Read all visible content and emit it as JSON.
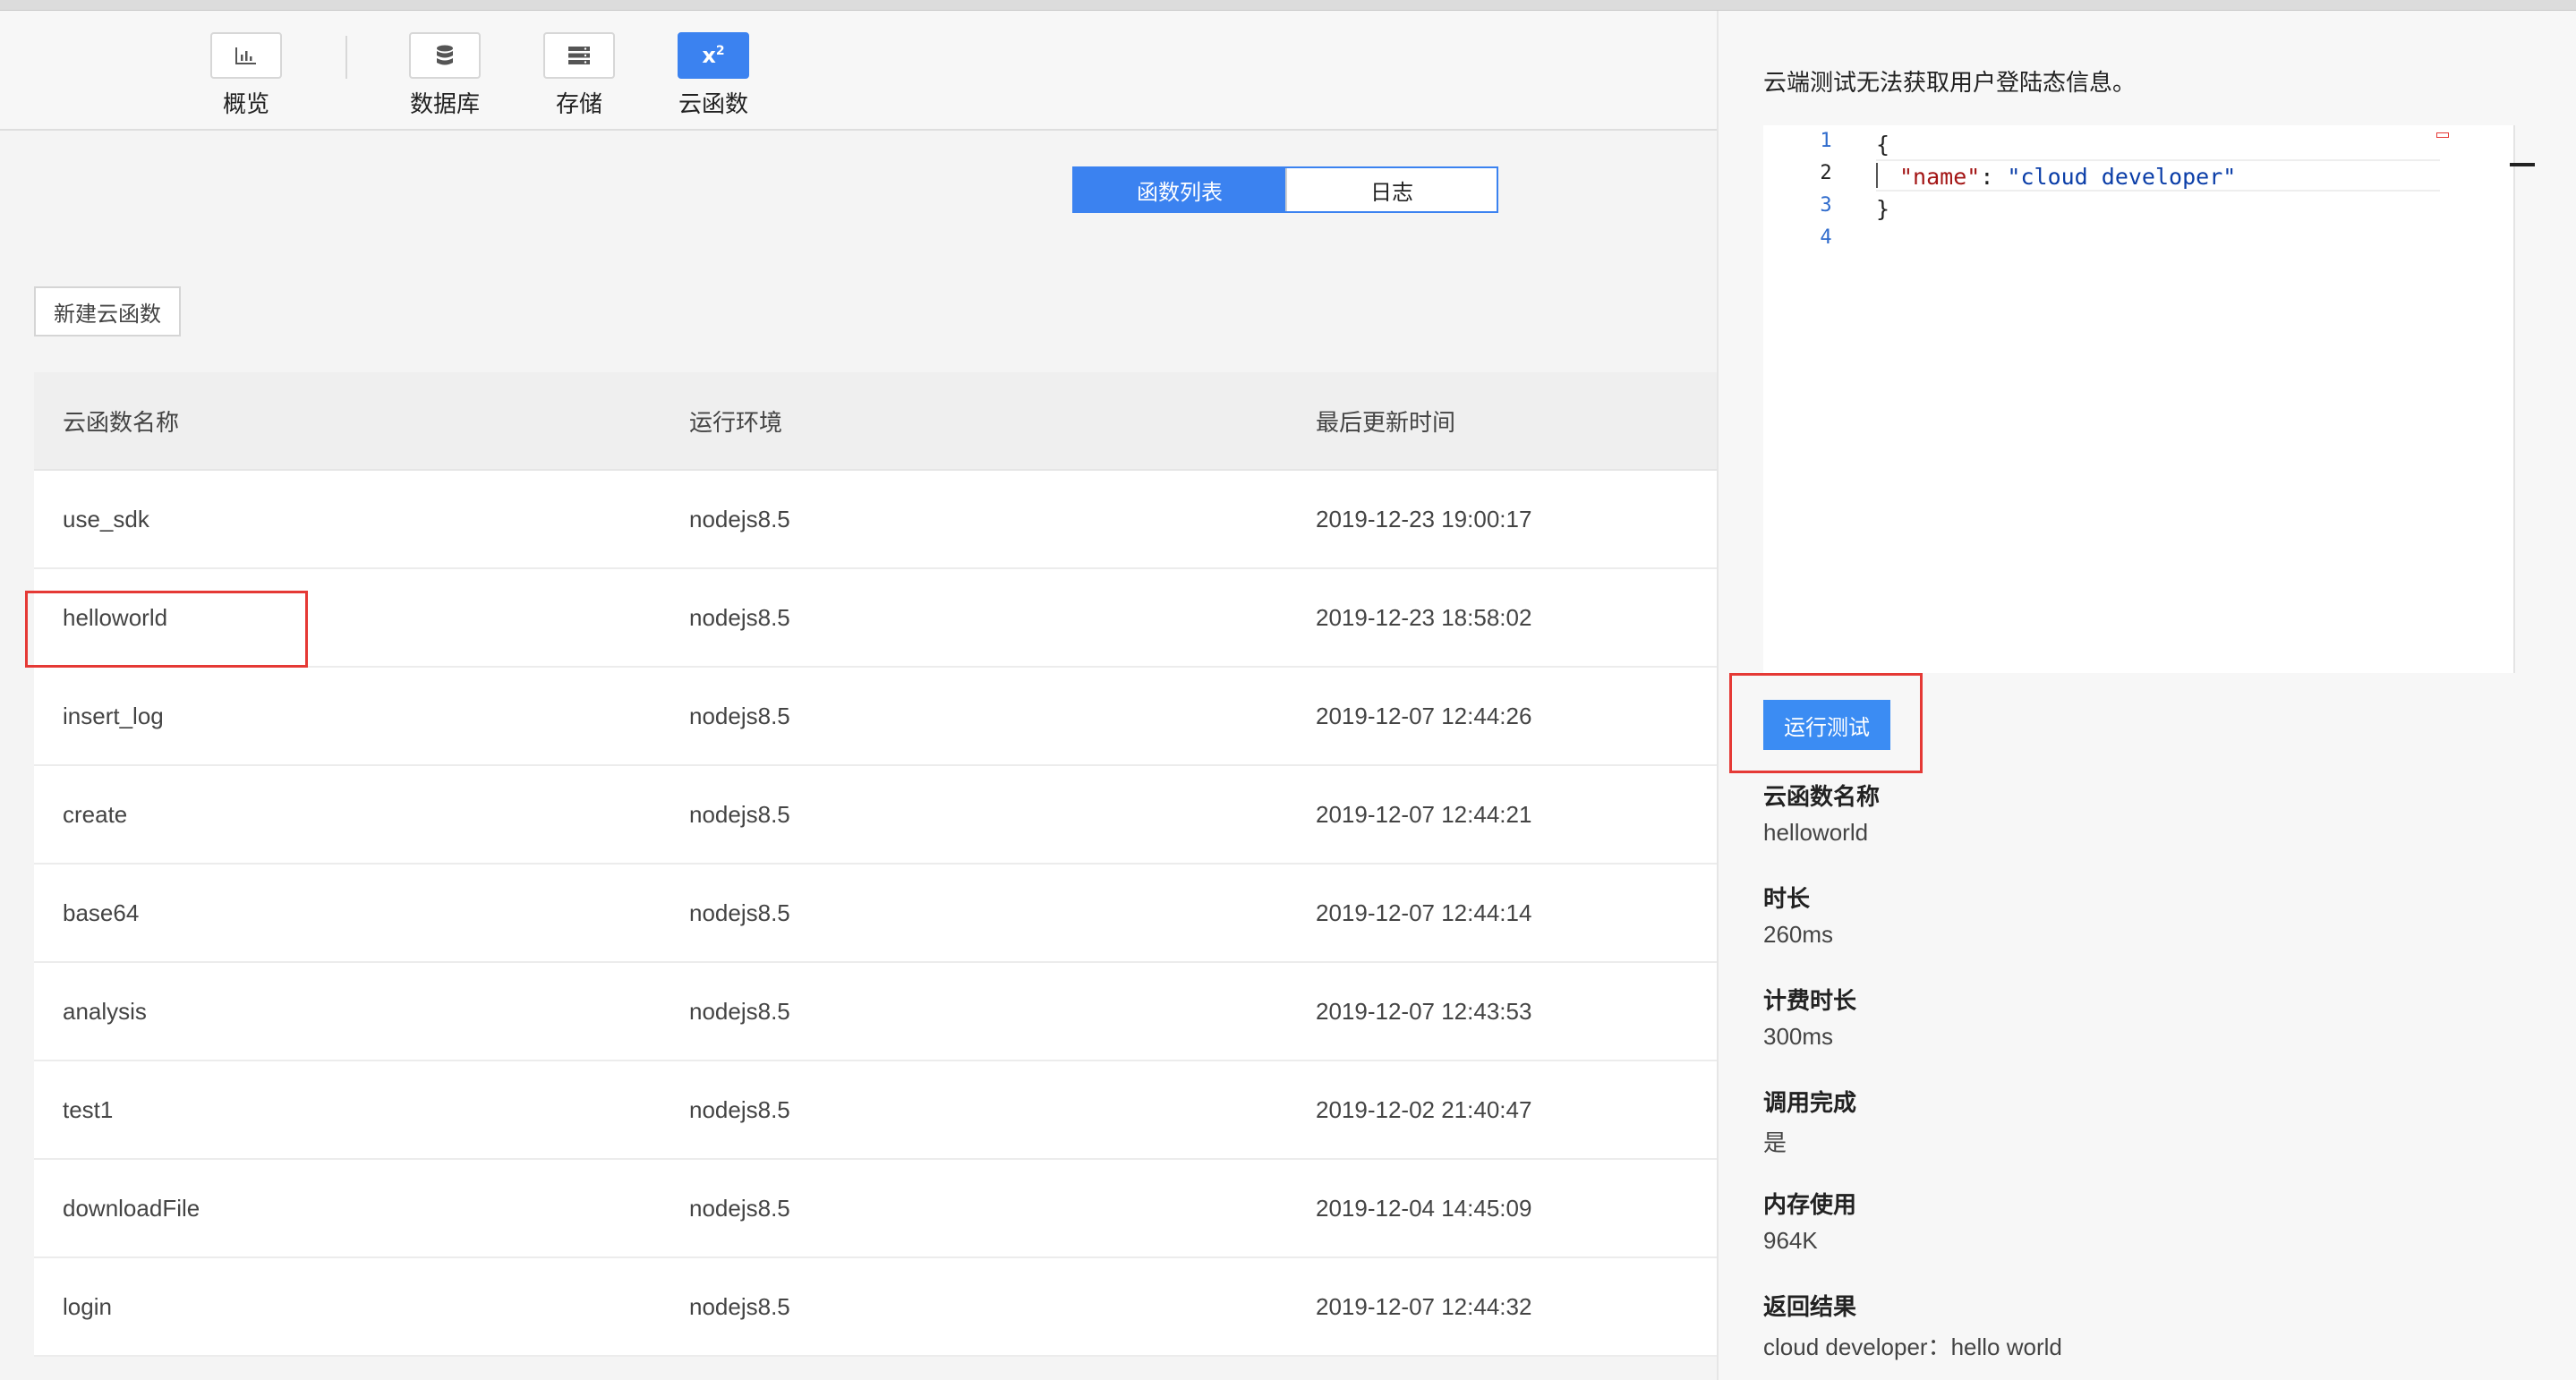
{
  "toolbar": {
    "items": [
      {
        "label": "概览",
        "icon": "chart-icon"
      },
      {
        "label": "数据库",
        "icon": "database-icon"
      },
      {
        "label": "存储",
        "icon": "storage-icon"
      },
      {
        "label": "云函数",
        "icon": "function-icon",
        "active": true
      }
    ]
  },
  "tabs": {
    "list": "函数列表",
    "log": "日志"
  },
  "new_function_button": "新建云函数",
  "table": {
    "headers": [
      "云函数名称",
      "运行环境",
      "最后更新时间"
    ],
    "rows": [
      [
        "use_sdk",
        "nodejs8.5",
        "2019-12-23 19:00:17"
      ],
      [
        "helloworld",
        "nodejs8.5",
        "2019-12-23 18:58:02"
      ],
      [
        "insert_log",
        "nodejs8.5",
        "2019-12-07 12:44:26"
      ],
      [
        "create",
        "nodejs8.5",
        "2019-12-07 12:44:21"
      ],
      [
        "base64",
        "nodejs8.5",
        "2019-12-07 12:44:14"
      ],
      [
        "analysis",
        "nodejs8.5",
        "2019-12-07 12:43:53"
      ],
      [
        "test1",
        "nodejs8.5",
        "2019-12-02 21:40:47"
      ],
      [
        "downloadFile",
        "nodejs8.5",
        "2019-12-04 14:45:09"
      ],
      [
        "login",
        "nodejs8.5",
        "2019-12-07 12:44:32"
      ]
    ]
  },
  "panel": {
    "notice": "云端测试无法获取用户登陆态信息。",
    "editor": {
      "line_numbers": [
        "1",
        "2",
        "3",
        "4"
      ],
      "line1": "{",
      "key": "\"name\"",
      "colon": ": ",
      "value": "\"cloud developer\"",
      "line3": "}"
    },
    "run_button": "运行测试",
    "results": [
      {
        "title": "云函数名称",
        "value": "helloworld"
      },
      {
        "title": "时长",
        "value": "260ms"
      },
      {
        "title": "计费时长",
        "value": "300ms"
      },
      {
        "title": "调用完成",
        "value": "是"
      },
      {
        "title": "内存使用",
        "value": "964K"
      },
      {
        "title": "返回结果",
        "value": "cloud developer：hello world"
      }
    ]
  },
  "colors": {
    "accent": "#3b82f0",
    "highlight": "#e53935"
  }
}
